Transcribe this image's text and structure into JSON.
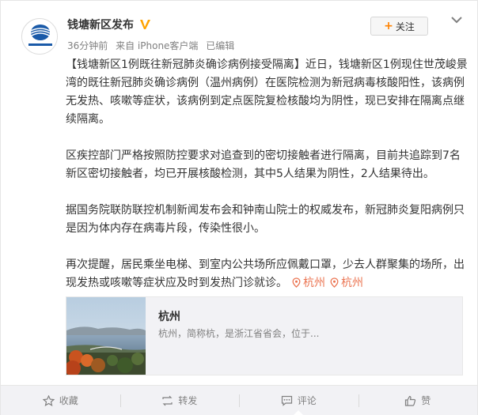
{
  "post": {
    "author": "钱塘新区发布",
    "verified_icon": "verified-v-icon",
    "time": "36分钟前",
    "source": "来自 iPhone客户端",
    "edited": "已编辑",
    "follow_label": "关注",
    "avatar_caption": "杭州钱塘新区"
  },
  "content": {
    "p1": "【钱塘新区1例既往新冠肺炎确诊病例接受隔离】近日，钱塘新区1例现住世茂峻景湾的既往新冠肺炎确诊病例（温州病例）在医院检测为新冠病毒核酸阳性，该病例无发热、咳嗽等症状，该病例到定点医院复检核酸均为阴性，现已安排在隔离点继续隔离。",
    "p2": "区疾控部门严格按照防控要求对追查到的密切接触者进行隔离，目前共追踪到7名新区密切接触者，均已开展核酸检测，其中5人结果为阴性，2人结果待出。",
    "p3": "据国务院联防联控机制新闻发布会和钟南山院士的权威发布，新冠肺炎复阳病例只是因为体内存在病毒片段，传染性很小。",
    "p4": "再次提醒，居民乘坐电梯、到室内公共场所应佩戴口罩，少去人群聚集的场所，出现发热或咳嗽等症状应及时到发热门诊就诊。",
    "location_links": [
      "杭州",
      "杭州"
    ]
  },
  "location_card": {
    "title": "杭州",
    "description": "杭州，简称杭，是浙江省省会，位于..."
  },
  "actions": {
    "favorite": "收藏",
    "repost": "转发",
    "comment": "评论",
    "like": "赞"
  },
  "colors": {
    "link": "#eb7350",
    "follow_plus": "#ff8200",
    "verified": "#ffa300",
    "footer_bg": "#f2f2f5"
  }
}
